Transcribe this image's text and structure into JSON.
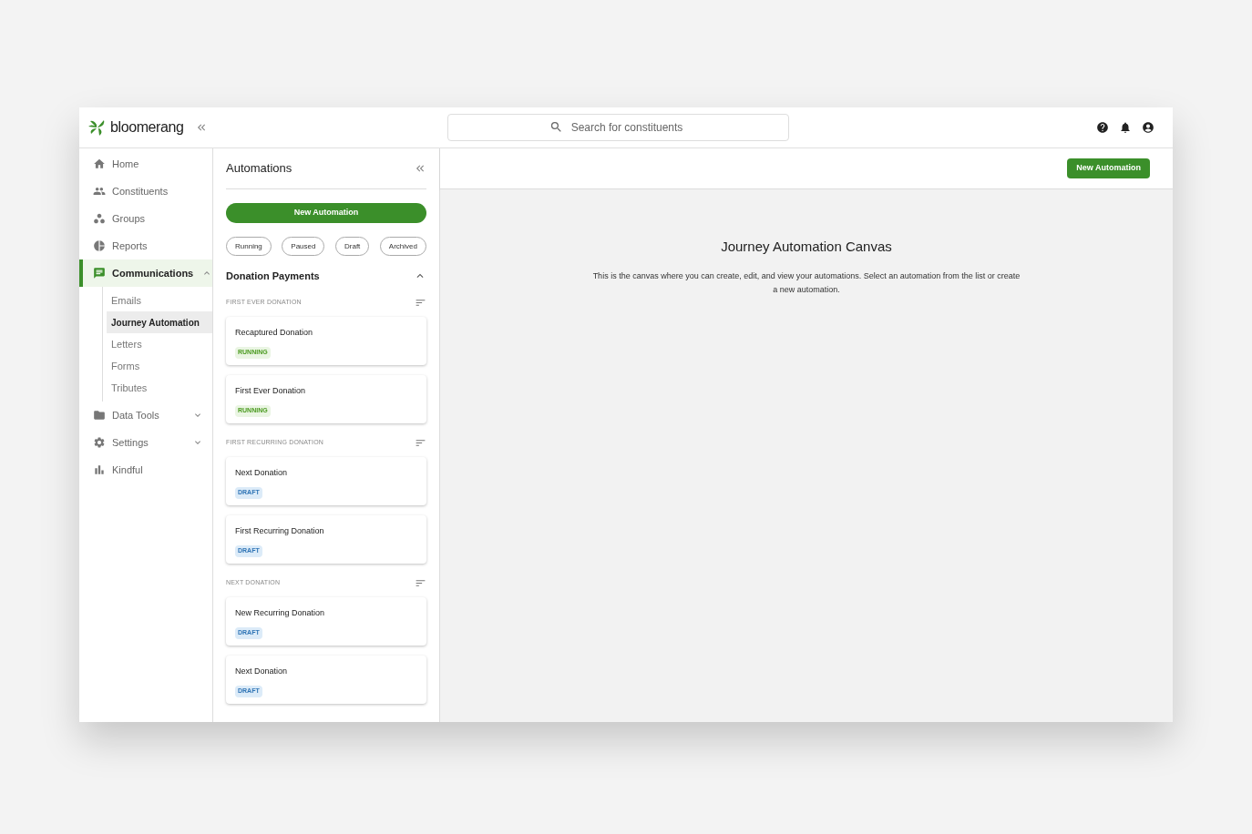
{
  "brand": {
    "name": "bloomerang"
  },
  "search": {
    "placeholder": "Search for constituents"
  },
  "nav": [
    {
      "label": "Home",
      "kind": "home",
      "selected": false
    },
    {
      "label": "Constituents",
      "kind": "people",
      "selected": false
    },
    {
      "label": "Groups",
      "kind": "groups",
      "selected": false
    },
    {
      "label": "Reports",
      "kind": "reports",
      "selected": false
    },
    {
      "label": "Communications",
      "kind": "chat",
      "selected": true,
      "expanded": true,
      "children": [
        {
          "label": "Emails",
          "selected": false
        },
        {
          "label": "Journey Automation",
          "selected": true
        },
        {
          "label": "Letters",
          "selected": false
        },
        {
          "label": "Forms",
          "selected": false
        },
        {
          "label": "Tributes",
          "selected": false
        }
      ]
    },
    {
      "label": "Data Tools",
      "kind": "folder",
      "selected": false,
      "expanded": false
    },
    {
      "label": "Settings",
      "kind": "gear",
      "selected": false,
      "expanded": false
    },
    {
      "label": "Kindful",
      "kind": "bars",
      "selected": false
    }
  ],
  "panel": {
    "title": "Automations",
    "new_button": "New Automation",
    "filters": [
      {
        "label": "Running",
        "selected": false
      },
      {
        "label": "Paused",
        "selected": false
      },
      {
        "label": "Draft",
        "selected": false
      },
      {
        "label": "Archived",
        "selected": false
      }
    ],
    "section": {
      "title": "Donation Payments",
      "expanded": true,
      "groups": [
        {
          "label": "FIRST EVER DONATION",
          "items": [
            {
              "name": "Recaptured Donation",
              "status": "RUNNING",
              "kind": "running"
            },
            {
              "name": "First Ever Donation",
              "status": "RUNNING",
              "kind": "running"
            }
          ]
        },
        {
          "label": "FIRST RECURRING DONATION",
          "items": [
            {
              "name": "Next Donation",
              "status": "DRAFT",
              "kind": "draft"
            },
            {
              "name": "First Recurring Donation",
              "status": "DRAFT",
              "kind": "draft"
            }
          ]
        },
        {
          "label": "NEXT DONATION",
          "items": [
            {
              "name": "New Recurring Donation",
              "status": "DRAFT",
              "kind": "draft"
            },
            {
              "name": "Next Donation",
              "status": "DRAFT",
              "kind": "draft"
            }
          ]
        }
      ]
    }
  },
  "canvas": {
    "button": "New Automation",
    "title": "Journey Automation Canvas",
    "text": "This is the canvas where you can create, edit, and view your automations. Select an automation from the list or create a new automation."
  }
}
